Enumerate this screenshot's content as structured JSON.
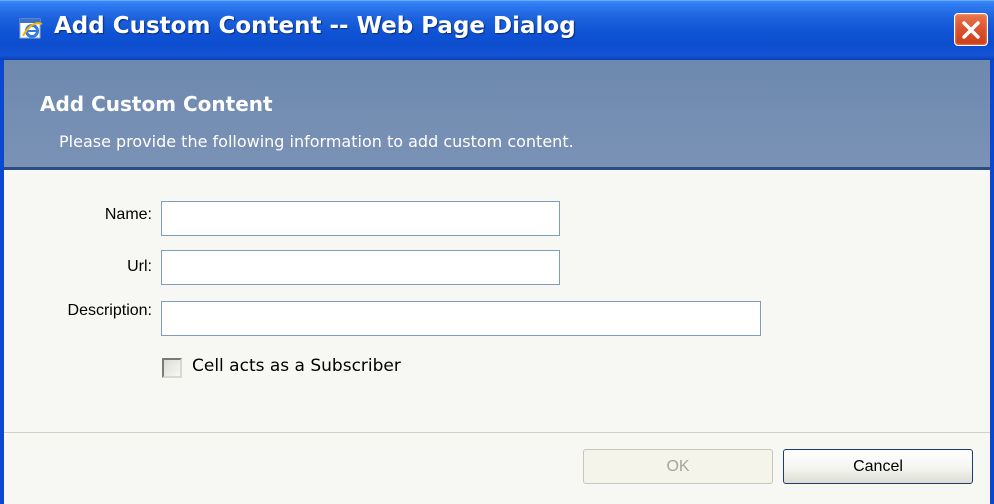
{
  "window": {
    "title": "Add Custom Content -- Web Page Dialog",
    "titlebar_color": "#0d4ecf",
    "close_icon": "close-icon"
  },
  "header": {
    "title": "Add Custom Content",
    "subtitle": "Please provide the following information to add custom content.",
    "background": "#7a92b6"
  },
  "form": {
    "name_label": "Name:",
    "name_value": "",
    "url_label": "Url:",
    "url_value": "",
    "description_label": "Description:",
    "description_value": "",
    "subscriber_checkbox": {
      "label": "Cell acts as a Subscriber",
      "checked": false
    }
  },
  "buttons": {
    "ok_label": "OK",
    "ok_enabled": false,
    "cancel_label": "Cancel"
  }
}
